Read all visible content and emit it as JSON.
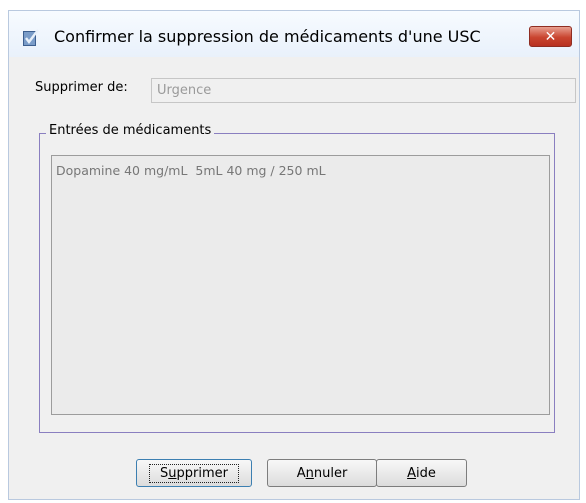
{
  "window": {
    "title": "Confirmer la suppression de médicaments d'une USC",
    "close_glyph": "✕",
    "icon": "checklist-app-icon"
  },
  "form": {
    "from_label": "Supprimer de:",
    "from_value": "Urgence"
  },
  "group": {
    "title": "Entrées de médicaments",
    "items": [
      "Dopamine 40 mg/mL  5mL 40 mg / 250 mL"
    ]
  },
  "buttons": {
    "delete": {
      "pre": "S",
      "mnemonic": "u",
      "post": "pprimer"
    },
    "cancel": {
      "pre": "A",
      "mnemonic": "n",
      "post": "nuler"
    },
    "help": {
      "pre": "",
      "mnemonic": "A",
      "post": "ide"
    }
  },
  "colors": {
    "dialog_bg": "#f0f0f0",
    "group_border": "#8a7fc0",
    "close_red": "#c9452f",
    "focus_blue": "#3c7fb1"
  }
}
